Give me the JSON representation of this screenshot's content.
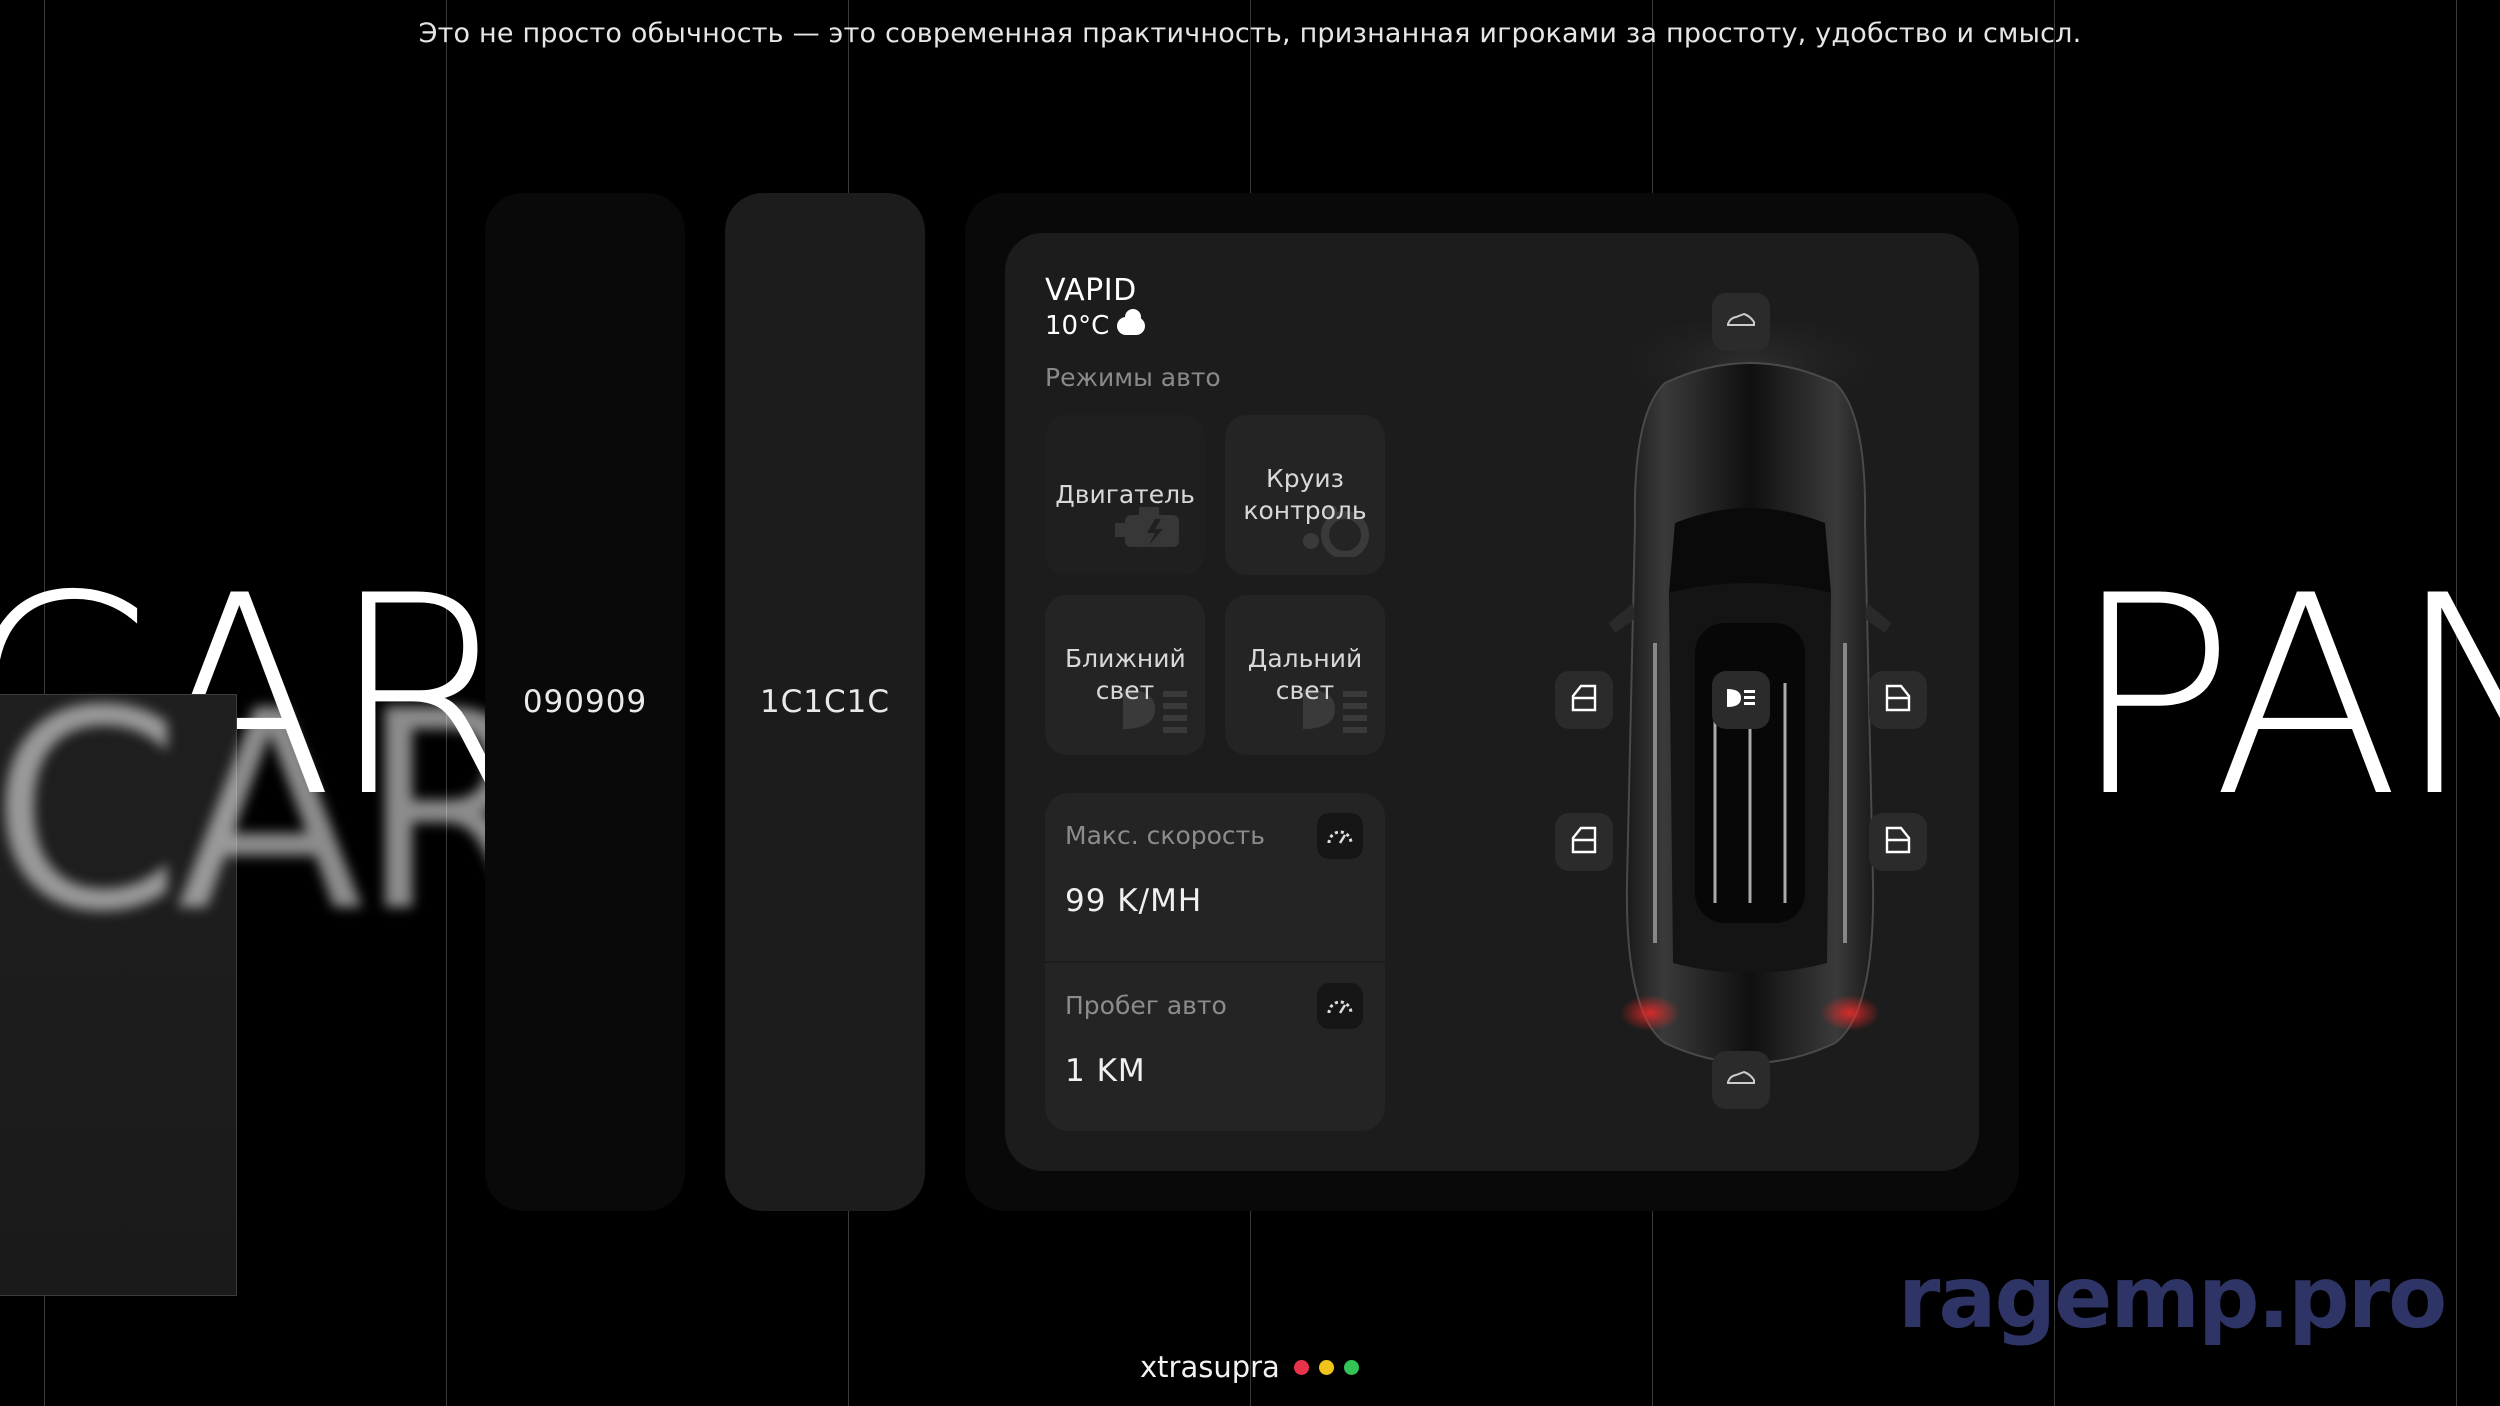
{
  "tagline": "Это не просто обычность — это современная практичность, признанная игроками за простоту, удобство и смысл.",
  "big_left": "CAR",
  "big_right": "PAN",
  "swatches": [
    {
      "label": "090909",
      "color": "#090909"
    },
    {
      "label": "1C1C1C",
      "color": "#1C1C1C"
    }
  ],
  "panel": {
    "brand": "VAPID",
    "temperature": "10°C",
    "weather_icon": "cloud-icon",
    "modes_title": "Режимы авто",
    "modes": [
      {
        "label": "Двигатель",
        "icon": "engine-icon"
      },
      {
        "label": "Круиз контроль",
        "icon": "cruise-icon"
      },
      {
        "label": "Ближний свет",
        "icon": "low-beam-icon"
      },
      {
        "label": "Дальний свет",
        "icon": "high-beam-icon"
      }
    ],
    "stats": [
      {
        "label": "Макс. скорость",
        "value": "99 K/MH",
        "icon": "speedometer-icon"
      },
      {
        "label": "Пробег авто",
        "value": "1 KM",
        "icon": "speedometer-icon"
      }
    ],
    "car_controls": [
      "hood-icon",
      "headlight-icon",
      "door-front-left-icon",
      "door-front-right-icon",
      "door-rear-left-icon",
      "door-rear-right-icon",
      "trunk-icon"
    ]
  },
  "footer": {
    "name": "xtrasupra",
    "dots": [
      "#e8334a",
      "#f0c419",
      "#33c458"
    ]
  },
  "watermark": "ragemp.pro"
}
